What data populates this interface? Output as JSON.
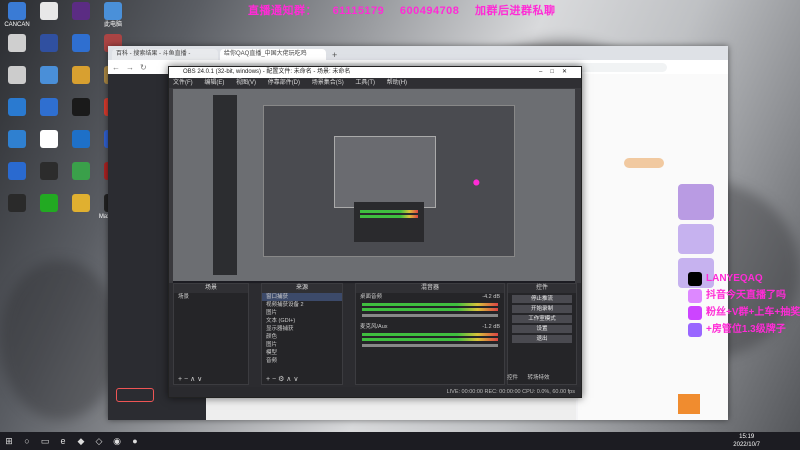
{
  "overlay": {
    "top_line": [
      "直播通知群：",
      "61115179",
      "600494708",
      "加群后进群私聊"
    ]
  },
  "desktop_icons": [
    {
      "label": "CANCAN",
      "color": "#3a7bd5"
    },
    {
      "label": "",
      "color": "#e8e8e8"
    },
    {
      "label": "",
      "color": "#5b2c83"
    },
    {
      "label": "此电脑",
      "color": "#4a90d9"
    },
    {
      "label": "",
      "color": "#cfcfcf"
    },
    {
      "label": "",
      "color": "#3050a0"
    },
    {
      "label": "",
      "color": "#2f6fd0"
    },
    {
      "label": "",
      "color": "#aa4444"
    },
    {
      "label": "",
      "color": "#cccccc"
    },
    {
      "label": "",
      "color": "#4a8fd8"
    },
    {
      "label": "",
      "color": "#d8a030"
    },
    {
      "label": "",
      "color": "#aa8844"
    },
    {
      "label": "",
      "color": "#2a7ad0"
    },
    {
      "label": "",
      "color": "#2f6fd0"
    },
    {
      "label": "",
      "color": "#1a1a1a"
    },
    {
      "label": "",
      "color": "#d83b2e"
    },
    {
      "label": "",
      "color": "#2f80d0"
    },
    {
      "label": "",
      "color": "#ffffff"
    },
    {
      "label": "",
      "color": "#1e70c8"
    },
    {
      "label": "",
      "color": "#3060d0"
    },
    {
      "label": "",
      "color": "#2a6ad0"
    },
    {
      "label": "",
      "color": "#2c2c2c"
    },
    {
      "label": "",
      "color": "#3aa04a"
    },
    {
      "label": "",
      "color": "#aa2222"
    },
    {
      "label": "",
      "color": "#2a2a2a"
    },
    {
      "label": "",
      "color": "#22aa22"
    },
    {
      "label": "",
      "color": "#e0b030"
    },
    {
      "label": "MaxPayne",
      "color": "#222222"
    }
  ],
  "browser": {
    "tabs": [
      "百科 - 搜索结果 - 斗鱼直播 - ",
      "给你QAQ直播_中国大佬玩吃鸡"
    ]
  },
  "obs": {
    "title": "OBS 24.0.1 (32-bit, windows) - 配置文件: 未命名 - 场景: 未命名",
    "menu": [
      "文件(F)",
      "编辑(E)",
      "视图(V)",
      "停靠部件(D)",
      "场景集合(S)",
      "工具(T)",
      "帮助(H)"
    ],
    "panels": {
      "scenes": {
        "title": "场景",
        "items": [
          "场景"
        ]
      },
      "sources": {
        "title": "来源",
        "items": [
          "窗口捕获",
          "视频捕获设备 2",
          "图片",
          "文本 (GDI+)",
          "显示器捕获",
          "颜色",
          "图片",
          "模型",
          "音频",
          "文字",
          "其他"
        ]
      },
      "mixer": {
        "title": "混音器",
        "items": [
          "桌面音频",
          "麦克风/Aux"
        ],
        "levels": [
          "-4.2 dB",
          "-1.2 dB"
        ]
      },
      "controls": {
        "title": "控件",
        "buttons": [
          "停止推流",
          "开始录制",
          "工作室模式",
          "设置",
          "退出"
        ]
      }
    },
    "transitions": [
      "控件",
      "转场特效"
    ],
    "status": "LIVE: 00:00:00   REC: 00:00:00   CPU: 0.0%, 60.00 fps"
  },
  "right_overlay": [
    {
      "text": "LANYEQAQ",
      "color": "#000000"
    },
    {
      "text": "抖音今天直播了吗",
      "color": "#dd88ff"
    },
    {
      "text": "粉丝+V群+上车+抽奖",
      "color": "#cc44ff"
    },
    {
      "text": "+房管位1.3级牌子",
      "color": "#9966ff"
    }
  ],
  "taskbar": {
    "time": "15:19",
    "date": "2022/10/7"
  }
}
